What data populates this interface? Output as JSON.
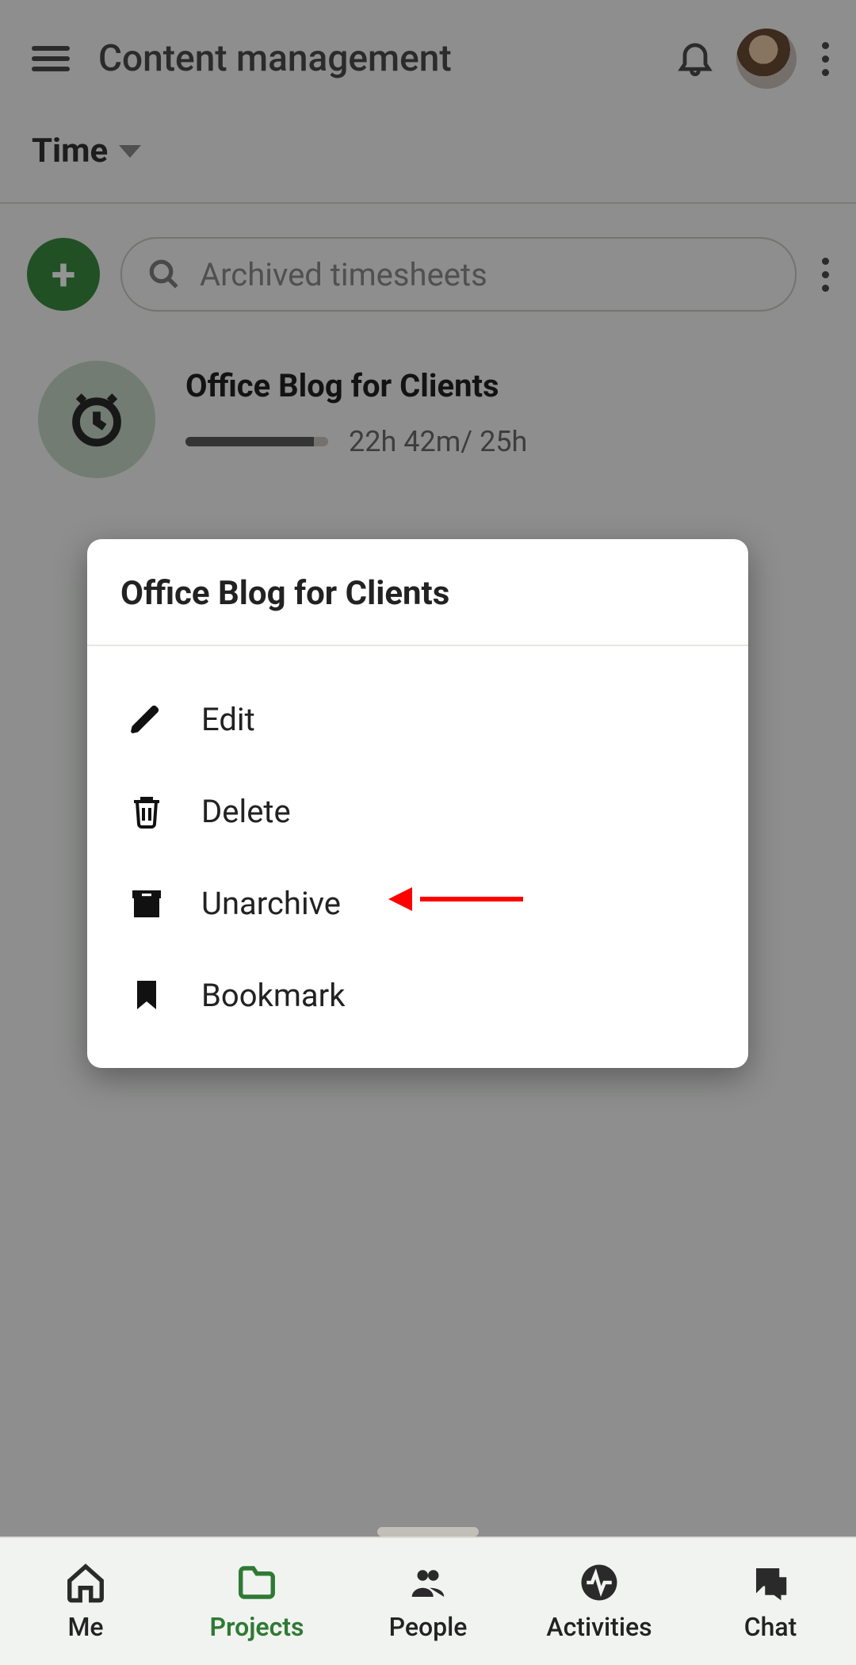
{
  "header": {
    "title": "Content management"
  },
  "filter": {
    "label": "Time"
  },
  "search": {
    "placeholder": "Archived timesheets"
  },
  "entry": {
    "title": "Office Blog for Clients",
    "elapsed": "22h 42m",
    "total": "25h",
    "progress_percent": 90
  },
  "modal": {
    "title": "Office Blog for Clients",
    "items": [
      {
        "icon": "edit",
        "label": "Edit"
      },
      {
        "icon": "delete",
        "label": "Delete"
      },
      {
        "icon": "unarchive",
        "label": "Unarchive"
      },
      {
        "icon": "bookmark",
        "label": "Bookmark"
      }
    ]
  },
  "nav": {
    "items": [
      {
        "label": "Me"
      },
      {
        "label": "Projects"
      },
      {
        "label": "People"
      },
      {
        "label": "Activities"
      },
      {
        "label": "Chat"
      }
    ],
    "active_index": 1
  },
  "colors": {
    "accent": "#3a8a3f",
    "text": "#222222",
    "muted": "#8a8a8a",
    "annotation": "#ff0000"
  }
}
